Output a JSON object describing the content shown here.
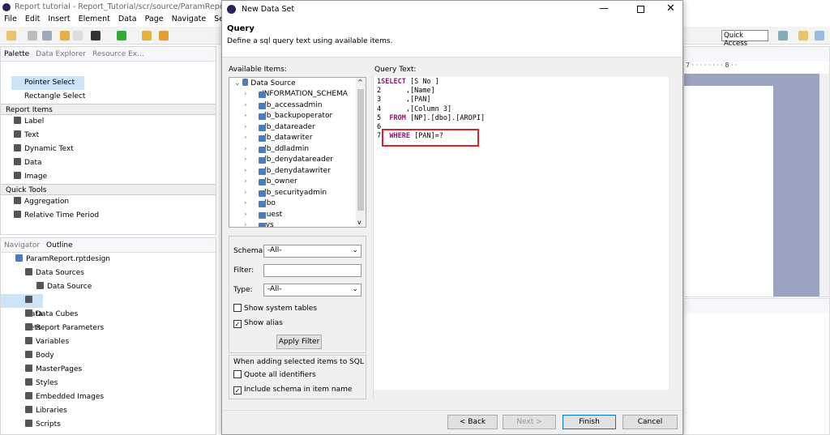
{
  "app": {
    "title": "Report tutorial - Report_Tutorial/scr/source/ParamReport.rptdesi",
    "menu": [
      "File",
      "Edit",
      "Insert",
      "Element",
      "Data",
      "Page",
      "Navigate",
      "Search"
    ],
    "quick_access": "Quick Access"
  },
  "palette": {
    "tabs": [
      "Palette",
      "Data Explorer",
      "Resource Ex..."
    ],
    "tools": [
      "Pointer Select",
      "Rectangle Select"
    ],
    "report_items_header": "Report Items",
    "report_items": [
      "Label",
      "Text",
      "Dynamic Text",
      "Data",
      "Image"
    ],
    "quick_tools_header": "Quick Tools",
    "quick_tools": [
      "Aggregation",
      "Relative Time Period"
    ]
  },
  "outline": {
    "tabs": [
      "Navigator",
      "Outline"
    ],
    "root": "ParamReport.rptdesign",
    "items": [
      "Data Sources",
      "Data Source",
      "Data Sets",
      "Data Cubes",
      "Report Parameters",
      "Variables",
      "Body",
      "MasterPages",
      "Styles",
      "Embedded Images",
      "Libraries",
      "Scripts"
    ]
  },
  "ruler": {
    "marks": [
      "7",
      "8"
    ]
  },
  "dialog": {
    "title": "New Data Set",
    "header": "Query",
    "description": "Define a sql query text using available items.",
    "available_label": "Available Items:",
    "root": "Data Source",
    "schemas": [
      "INFORMATION_SCHEMA",
      "db_accessadmin",
      "db_backupoperator",
      "db_datareader",
      "db_datawriter",
      "db_ddladmin",
      "db_denydatareader",
      "db_denydatawriter",
      "db_owner",
      "db_securityadmin",
      "dbo",
      "guest",
      "sys"
    ],
    "schema_label": "Schema:",
    "schema_value": "-All-",
    "filter_label": "Filter:",
    "filter_value": "",
    "type_label": "Type:",
    "type_value": "-All-",
    "show_system_tables": "Show system tables",
    "show_alias": "Show alias",
    "apply_filter": "Apply Filter",
    "sql_group": "When adding selected items to SQL",
    "quote_all": "Quote all identifiers",
    "include_schema": "Include schema in item name",
    "query_label": "Query Text:",
    "query_lines": [
      {
        "n": "1",
        "kw": "SELECT",
        "rest": " [S No ]"
      },
      {
        "n": "2",
        "kw": "",
        "rest": "      ,[Name]"
      },
      {
        "n": "3",
        "kw": "",
        "rest": "      ,[PAN]"
      },
      {
        "n": "4",
        "kw": "",
        "rest": "      ,[Column 3]"
      },
      {
        "n": "5",
        "kw": "  FROM",
        "rest": " [NP].[dbo].[AROPI]"
      },
      {
        "n": "6",
        "kw": "",
        "rest": ""
      },
      {
        "n": "7",
        "kw": "  WHERE",
        "rest": " [PAN]=?"
      }
    ],
    "buttons": {
      "back": "< Back",
      "next": "Next >",
      "finish": "Finish",
      "cancel": "Cancel"
    },
    "highlight_color": "#e0202b"
  }
}
